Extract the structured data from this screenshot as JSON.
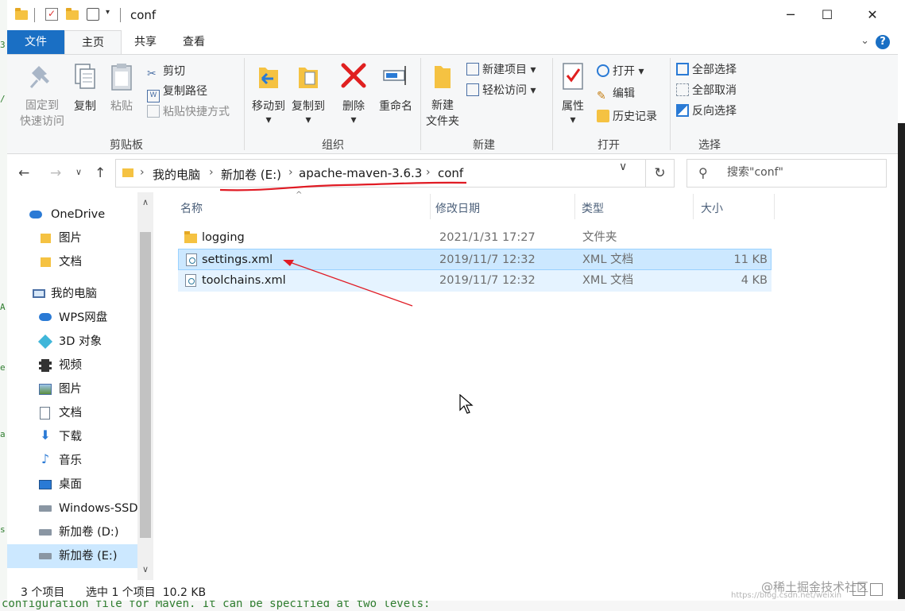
{
  "window": {
    "title": "conf",
    "controls": {
      "minimize": "─",
      "maximize": "☐",
      "close": "✕"
    }
  },
  "ribbon": {
    "tabs": [
      "文件",
      "主页",
      "共享",
      "查看"
    ],
    "active_tab": "主页",
    "groups": {
      "clipboard": {
        "label": "剪贴板",
        "pin_quick_access": "固定到\n快速访问",
        "copy": "复制",
        "paste": "粘贴",
        "cut": "剪切",
        "copy_path": "复制路径",
        "paste_shortcut": "粘贴快捷方式"
      },
      "organize": {
        "label": "组织",
        "move_to": "移动到",
        "copy_to": "复制到",
        "delete": "删除",
        "rename": "重命名"
      },
      "new": {
        "label": "新建",
        "new_folder": "新建\n文件夹",
        "new_item": "新建项目",
        "easy_access": "轻松访问"
      },
      "open": {
        "label": "打开",
        "properties": "属性",
        "open": "打开",
        "edit": "编辑",
        "history": "历史记录"
      },
      "select": {
        "label": "选择",
        "select_all": "全部选择",
        "select_none": "全部取消",
        "invert": "反向选择"
      }
    }
  },
  "address_bar": {
    "crumbs": [
      "我的电脑",
      "新加卷 (E:)",
      "apache-maven-3.6.3",
      "conf"
    ]
  },
  "search": {
    "placeholder": "搜索\"conf\""
  },
  "navigation_pane": {
    "items": [
      {
        "label": "OneDrive",
        "icon": "onedrive-icon"
      },
      {
        "label": "图片",
        "icon": "folder-icon"
      },
      {
        "label": "文档",
        "icon": "folder-icon"
      },
      {
        "label": "我的电脑",
        "icon": "computer-icon"
      },
      {
        "label": "WPS网盘",
        "icon": "cloud-icon"
      },
      {
        "label": "3D 对象",
        "icon": "cube-icon"
      },
      {
        "label": "视频",
        "icon": "video-icon"
      },
      {
        "label": "图片",
        "icon": "pictures-icon"
      },
      {
        "label": "文档",
        "icon": "documents-icon"
      },
      {
        "label": "下载",
        "icon": "download-icon"
      },
      {
        "label": "音乐",
        "icon": "music-icon"
      },
      {
        "label": "桌面",
        "icon": "desktop-icon"
      },
      {
        "label": "Windows-SSD",
        "icon": "drive-icon"
      },
      {
        "label": "新加卷 (D:)",
        "icon": "drive-icon"
      },
      {
        "label": "新加卷 (E:)",
        "icon": "drive-icon"
      }
    ],
    "selected": "新加卷 (E:)"
  },
  "file_list": {
    "columns": [
      "名称",
      "修改日期",
      "类型",
      "大小"
    ],
    "rows": [
      {
        "name": "logging",
        "modified": "2021/1/31 17:27",
        "type": "文件夹",
        "size": ""
      },
      {
        "name": "settings.xml",
        "modified": "2019/11/7 12:32",
        "type": "XML 文档",
        "size": "11 KB"
      },
      {
        "name": "toolchains.xml",
        "modified": "2019/11/7 12:32",
        "type": "XML 文档",
        "size": "4 KB"
      }
    ],
    "selected_row": "settings.xml"
  },
  "status_bar": {
    "item_count": "3 个项目",
    "selection": "选中 1 个项目  10.2 KB"
  },
  "background": {
    "editor_text": "configuration file for Maven. It can be specified at two levels:"
  },
  "watermark": {
    "main": "@稀土掘金技术社区",
    "sub": "https://blog.csdn.net/weixin"
  },
  "colors": {
    "accent": "#1a6fc4",
    "selection": "#cce8ff",
    "annotation": "#e01b24"
  }
}
